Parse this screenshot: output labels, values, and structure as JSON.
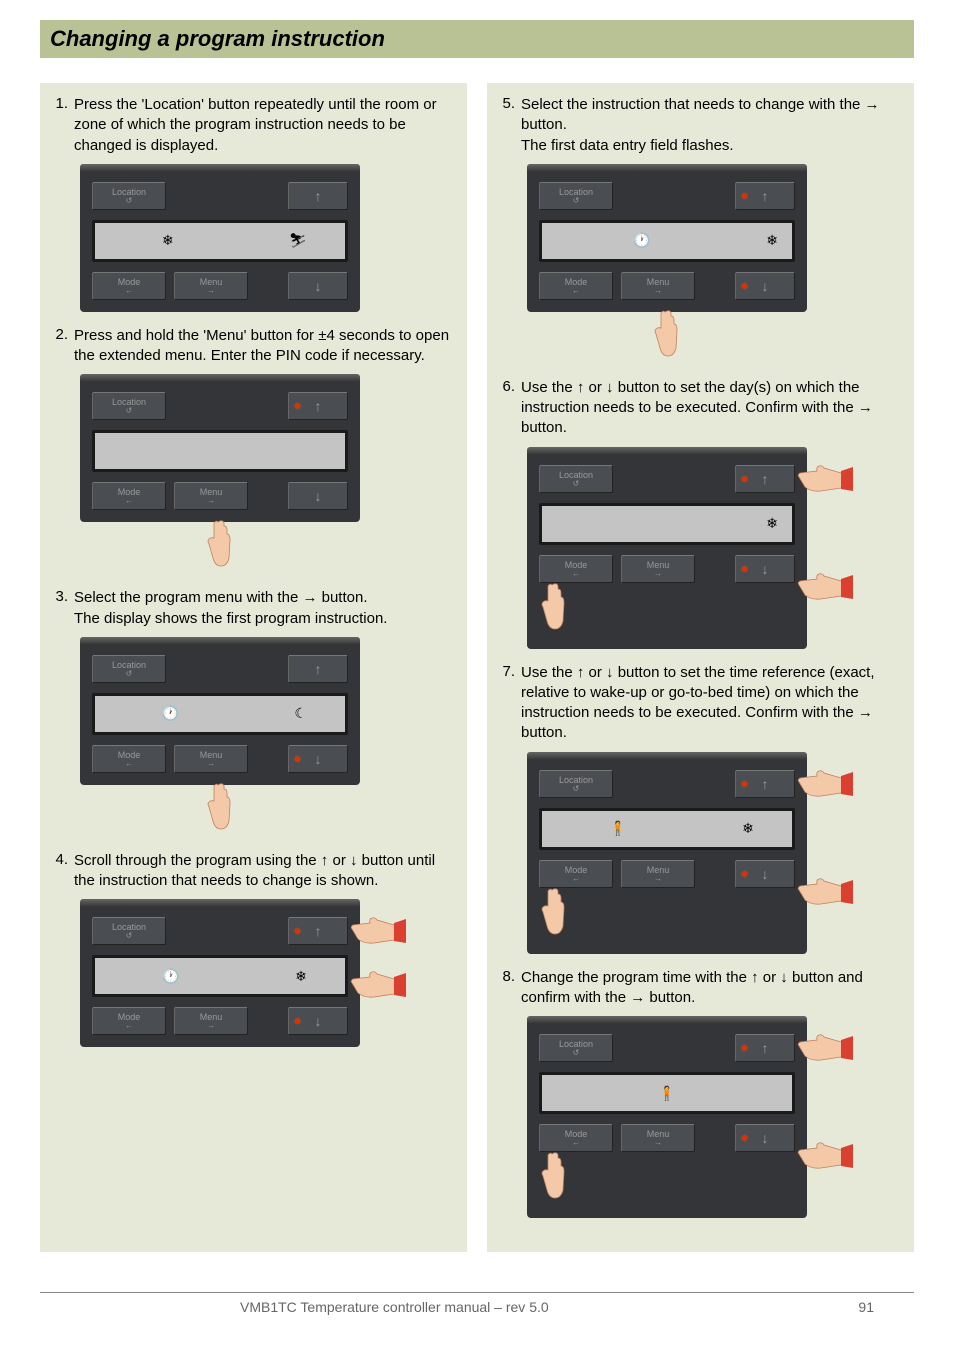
{
  "header": "Changing a program instruction",
  "buttons": {
    "location": "Location",
    "location_sub": "↺",
    "mode": "Mode",
    "mode_sub": "←",
    "menu": "Menu",
    "menu_sub": "→",
    "up": "↑",
    "down": "↓"
  },
  "lcd": {
    "snow": "❄",
    "footprints": "👣",
    "clock": "🕐",
    "moon": "☾",
    "sun": "☀",
    "person": "🧍",
    "gear": "⚙"
  },
  "steps_left": [
    {
      "n": "1.",
      "text": "Press the 'Location' button repeatedly until the room or zone of which the program instruction needs to be changed is displayed.",
      "device": {
        "lcd_icons": [
          "snow",
          "footprints"
        ],
        "leds": [],
        "hand": null
      }
    },
    {
      "n": "2.",
      "text": "Press and hold the 'Menu' button for ±4 seconds to open the extended menu. Enter the PIN code if necessary.",
      "device": {
        "lcd_icons": [],
        "leds": [
          "up"
        ],
        "hand": "bottom"
      }
    },
    {
      "n": "3.",
      "text": "Select the program menu with the → button.\nThe display shows the first program instruction.",
      "device": {
        "lcd_icons": [
          "clock",
          "moon"
        ],
        "leds": [
          "down"
        ],
        "hand": "bottom"
      }
    },
    {
      "n": "4.",
      "text": "Scroll through the program using the ↑ or ↓ button until the instruction that needs to change is shown.",
      "device": {
        "lcd_icons": [
          "clock",
          "snow"
        ],
        "leds": [
          "up",
          "down"
        ],
        "hand": "right"
      }
    }
  ],
  "steps_right": [
    {
      "n": "5.",
      "text": "Select the instruction that needs to change with the → button.\nThe first data entry field flashes.",
      "device": {
        "lcd_icons": [
          "clock",
          "snow"
        ],
        "leds": [
          "up",
          "down"
        ],
        "hand": "bottom",
        "lcd_offset": true
      }
    },
    {
      "n": "6.",
      "text": "Use the ↑ or ↓ button to set the day(s) on which the instruction needs to be executed. Confirm with the → button.",
      "device": {
        "lcd_icons": [
          "snow"
        ],
        "leds": [
          "up",
          "down"
        ],
        "hand": "bottom-right",
        "lcd_right": true
      }
    },
    {
      "n": "7.",
      "text": "Use the ↑ or ↓ button to set the time reference (exact, relative to wake-up or go-to-bed time) on which the instruction needs to be executed. Confirm with the → button.",
      "device": {
        "lcd_icons": [
          "person",
          "snow"
        ],
        "leds": [
          "up",
          "down"
        ],
        "hand": "bottom-right"
      }
    },
    {
      "n": "8.",
      "text": "Change the program time with the ↑ or ↓ button and confirm with the → button.",
      "device": {
        "lcd_icons": [
          "person"
        ],
        "leds": [
          "up",
          "down"
        ],
        "hand": "bottom-right",
        "lcd_center": true
      }
    }
  ],
  "footer": {
    "title": "VMB1TC Temperature controller manual – rev 5.0",
    "page": "91"
  }
}
